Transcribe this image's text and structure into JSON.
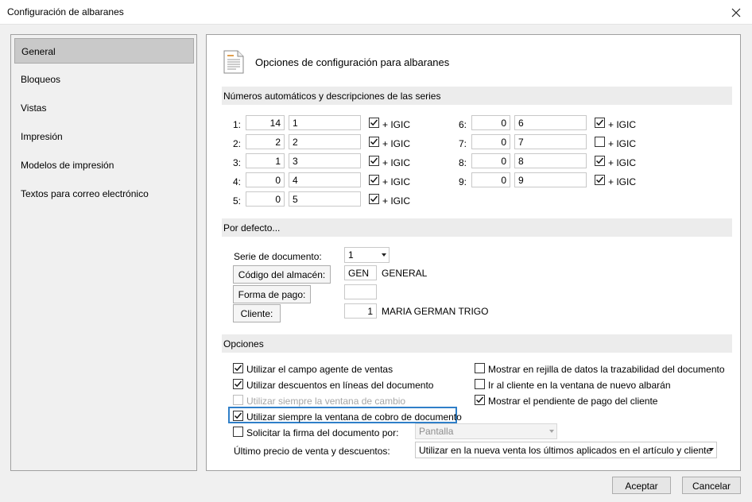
{
  "window": {
    "title": "Configuración de albaranes"
  },
  "sidebar": {
    "items": [
      {
        "label": "General"
      },
      {
        "label": "Bloqueos"
      },
      {
        "label": "Vistas"
      },
      {
        "label": "Impresión"
      },
      {
        "label": "Modelos de impresión"
      },
      {
        "label": "Textos para correo electrónico"
      }
    ]
  },
  "header": {
    "title": "Opciones de configuración para albaranes"
  },
  "series_section": {
    "title": "Números automáticos y descripciones de las series",
    "igic_label": "+ IGIC",
    "rows": [
      {
        "label": "1:",
        "number": "14",
        "desc": "1",
        "igic": true
      },
      {
        "label": "2:",
        "number": "2",
        "desc": "2",
        "igic": true
      },
      {
        "label": "3:",
        "number": "1",
        "desc": "3",
        "igic": true
      },
      {
        "label": "4:",
        "number": "0",
        "desc": "4",
        "igic": true
      },
      {
        "label": "5:",
        "number": "0",
        "desc": "5",
        "igic": true
      },
      {
        "label": "6:",
        "number": "0",
        "desc": "6",
        "igic": true
      },
      {
        "label": "7:",
        "number": "0",
        "desc": "7",
        "igic": false
      },
      {
        "label": "8:",
        "number": "0",
        "desc": "8",
        "igic": true
      },
      {
        "label": "9:",
        "number": "0",
        "desc": "9",
        "igic": true
      }
    ]
  },
  "defaults_section": {
    "title": "Por defecto...",
    "serie_label": "Serie de documento:",
    "serie_value": "1",
    "almacen_button": "Código del almacén:",
    "almacen_code": "GEN",
    "almacen_name": "GENERAL",
    "pago_button": "Forma de pago:",
    "pago_value": "",
    "cliente_button": "Cliente:",
    "cliente_code": "1",
    "cliente_name": "MARIA GERMAN TRIGO"
  },
  "options_section": {
    "title": "Opciones",
    "left": [
      {
        "label": "Utilizar el campo agente de ventas",
        "checked": true,
        "disabled": false
      },
      {
        "label": "Utilizar descuentos en líneas del documento",
        "checked": true,
        "disabled": false
      },
      {
        "label": "Utilizar siempre la ventana de cambio",
        "checked": false,
        "disabled": true
      },
      {
        "label": "Utilizar siempre la ventana de cobro de documento",
        "checked": true,
        "disabled": false
      },
      {
        "label": "Solicitar la firma del documento por:",
        "checked": false,
        "disabled": false
      }
    ],
    "right": [
      {
        "label": "Mostrar en rejilla de datos la trazabilidad del documento",
        "checked": false
      },
      {
        "label": "Ir al cliente en la ventana de nuevo albarán",
        "checked": false
      },
      {
        "label": "Mostrar el pendiente de pago del cliente",
        "checked": true
      }
    ],
    "firma_select": "Pantalla",
    "precio_label": "Último precio de venta y descuentos:",
    "precio_select": "Utilizar en la nueva venta los últimos aplicados en el artículo y cliente"
  },
  "footer": {
    "accept": "Aceptar",
    "cancel": "Cancelar"
  }
}
